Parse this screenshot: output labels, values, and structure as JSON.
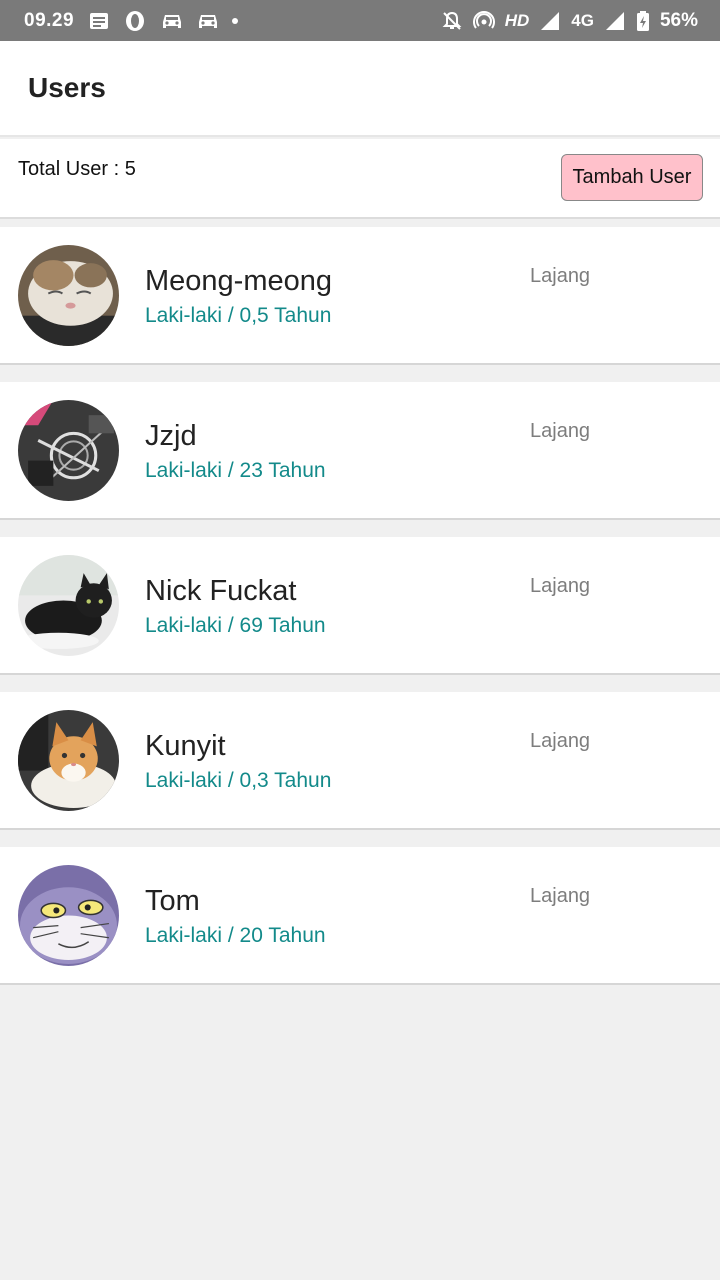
{
  "status_bar": {
    "time": "09.29",
    "network_hd": "HD",
    "network_type": "4G",
    "battery": "56%"
  },
  "app_bar": {
    "title": "Users"
  },
  "summary": {
    "total_label": "Total User : 5",
    "add_button": "Tambah User"
  },
  "users": [
    {
      "name": "Meong-meong",
      "details": "Laki-laki / 0,5 Tahun",
      "status": "Lajang"
    },
    {
      "name": "Jzjd",
      "details": "Laki-laki / 23 Tahun",
      "status": "Lajang"
    },
    {
      "name": "Nick Fuckat",
      "details": "Laki-laki / 69 Tahun",
      "status": "Lajang"
    },
    {
      "name": "Kunyit",
      "details": "Laki-laki / 0,3 Tahun",
      "status": "Lajang"
    },
    {
      "name": "Tom",
      "details": "Laki-laki / 20 Tahun",
      "status": "Lajang"
    }
  ],
  "colors": {
    "status_bar": "#7a7a7a",
    "accent_text": "#138a8a",
    "button_bg": "#ffc1cb",
    "page_bg": "#f0f0f0"
  }
}
